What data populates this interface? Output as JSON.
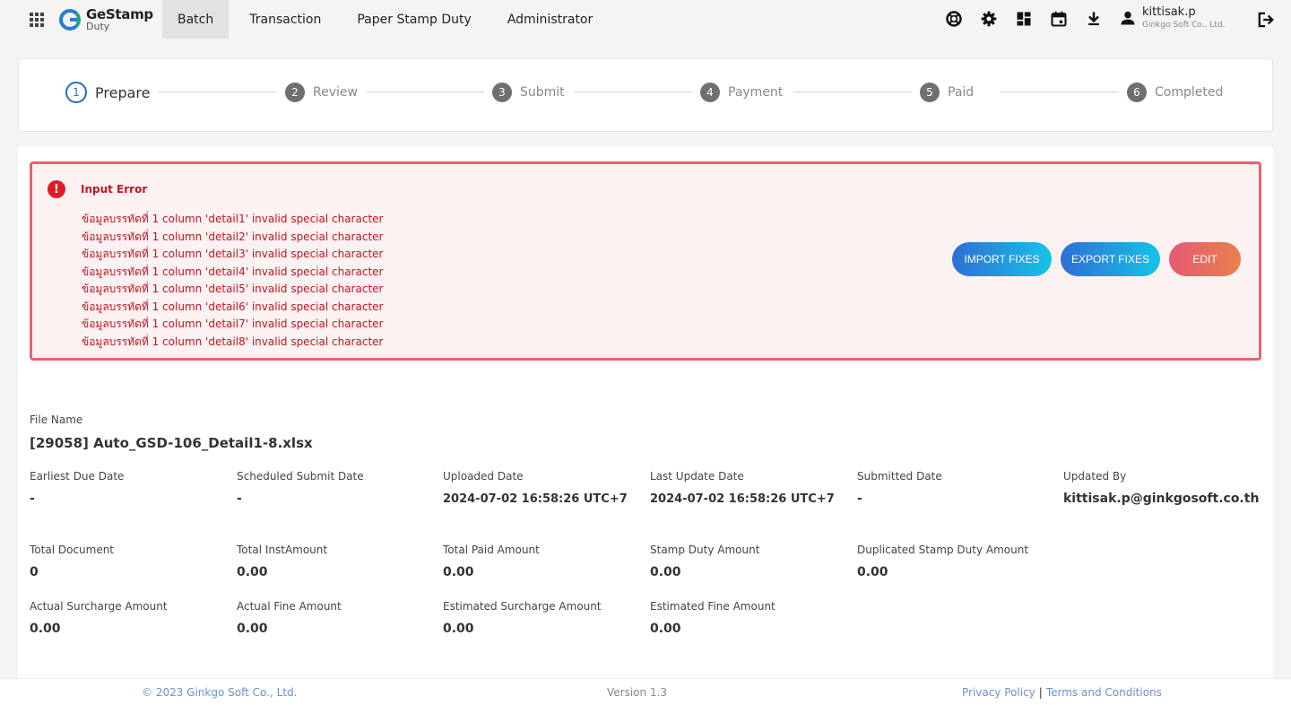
{
  "app": {
    "logo_line1": "GeStamp",
    "logo_line2": "Duty"
  },
  "nav": [
    {
      "label": "Batch",
      "active": true
    },
    {
      "label": "Transaction"
    },
    {
      "label": "Paper Stamp Duty"
    },
    {
      "label": "Administrator"
    }
  ],
  "header_icons": [
    "help-icon",
    "settings-icon",
    "dashboard-icon",
    "calendar-icon",
    "download-icon"
  ],
  "user": {
    "name": "kittisak.p",
    "org": "Ginkgo Soft Co., Ltd."
  },
  "stepper": {
    "steps": [
      {
        "num": "1",
        "label": "Prepare"
      },
      {
        "num": "2",
        "label": "Review"
      },
      {
        "num": "3",
        "label": "Submit"
      },
      {
        "num": "4",
        "label": "Payment"
      },
      {
        "num": "5",
        "label": "Paid"
      },
      {
        "num": "6",
        "label": "Completed"
      }
    ],
    "current": 1
  },
  "error": {
    "icon": "!",
    "title": "Input Error",
    "lines": [
      "ข้อมูลบรรทัดที่ 1 column 'detail1' invalid special character",
      "ข้อมูลบรรทัดที่ 1 column 'detail2' invalid special character",
      "ข้อมูลบรรทัดที่ 1 column 'detail3' invalid special character",
      "ข้อมูลบรรทัดที่ 1 column 'detail4' invalid special character",
      "ข้อมูลบรรทัดที่ 1 column 'detail5' invalid special character",
      "ข้อมูลบรรทัดที่ 1 column 'detail6' invalid special character",
      "ข้อมูลบรรทัดที่ 1 column 'detail7' invalid special character",
      "ข้อมูลบรรทัดที่ 1 column 'detail8' invalid special character"
    ],
    "buttons": {
      "import": "IMPORT FIXES",
      "export": "EXPORT FIXES",
      "edit": "EDIT"
    }
  },
  "file": {
    "label": "File Name",
    "value": "[29058] Auto_GSD-106_Detail1-8.xlsx"
  },
  "fields": [
    {
      "label": "Earliest Due Date",
      "value": "-"
    },
    {
      "label": "Scheduled Submit Date",
      "value": "-"
    },
    {
      "label": "Uploaded Date",
      "value": "2024-07-02 16:58:26 UTC+7"
    },
    {
      "label": "Last Update Date",
      "value": "2024-07-02 16:58:26 UTC+7"
    },
    {
      "label": "Submitted Date",
      "value": "-"
    },
    {
      "label": "Updated By",
      "value": "kittisak.p@ginkgosoft.co.th"
    },
    {
      "label": "Total Document",
      "value": "0"
    },
    {
      "label": "Total InstAmount",
      "value": "0.00"
    },
    {
      "label": "Total Paid Amount",
      "value": "0.00"
    },
    {
      "label": "Stamp Duty Amount",
      "value": "0.00"
    },
    {
      "label": "Duplicated Stamp Duty Amount",
      "value": "0.00"
    },
    {
      "label": "Actual Surcharge Amount",
      "value": "0.00"
    },
    {
      "label": "Actual Fine Amount",
      "value": "0.00"
    },
    {
      "label": "Estimated Surcharge Amount",
      "value": "0.00"
    },
    {
      "label": "Estimated Fine Amount",
      "value": "0.00"
    }
  ],
  "footer": {
    "copyright": "© 2023 Ginkgo Soft Co., Ltd.",
    "version": "Version 1.3",
    "privacy": "Privacy Policy",
    "separator": "|",
    "terms": "Terms and Conditions"
  }
}
